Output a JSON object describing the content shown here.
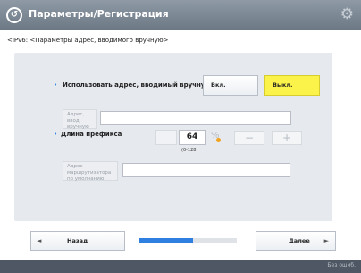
{
  "header": {
    "title": "Параметры/Регистрация",
    "back_icon": "circle-arrow-icon",
    "settings_icon": "gear-icon"
  },
  "subtitle": "<IPv6: <Параметры адрес, вводимого вручную>",
  "form": {
    "use_manual": {
      "label": "Использовать адрес, вводимый вручную",
      "on_label": "Вкл.",
      "off_label": "Выкл.",
      "selected": "off"
    },
    "manual_address": {
      "button_label": "Адрес, ввод. вручную",
      "value": ""
    },
    "prefix_length": {
      "label": "Длина префикса",
      "value": "64",
      "range": "(0-128)",
      "minus_label": "−",
      "plus_label": "+"
    },
    "default_router": {
      "button_label": "Адрес маршрутизатора по умолчанию",
      "value": ""
    }
  },
  "footer": {
    "back_label": "Назад",
    "next_label": "Далее",
    "progress_fraction": 0.55
  },
  "status": {
    "text": "Без ошиб."
  },
  "colors": {
    "accent": "#2f7fe0",
    "selected_yellow": "#fbf24a"
  }
}
